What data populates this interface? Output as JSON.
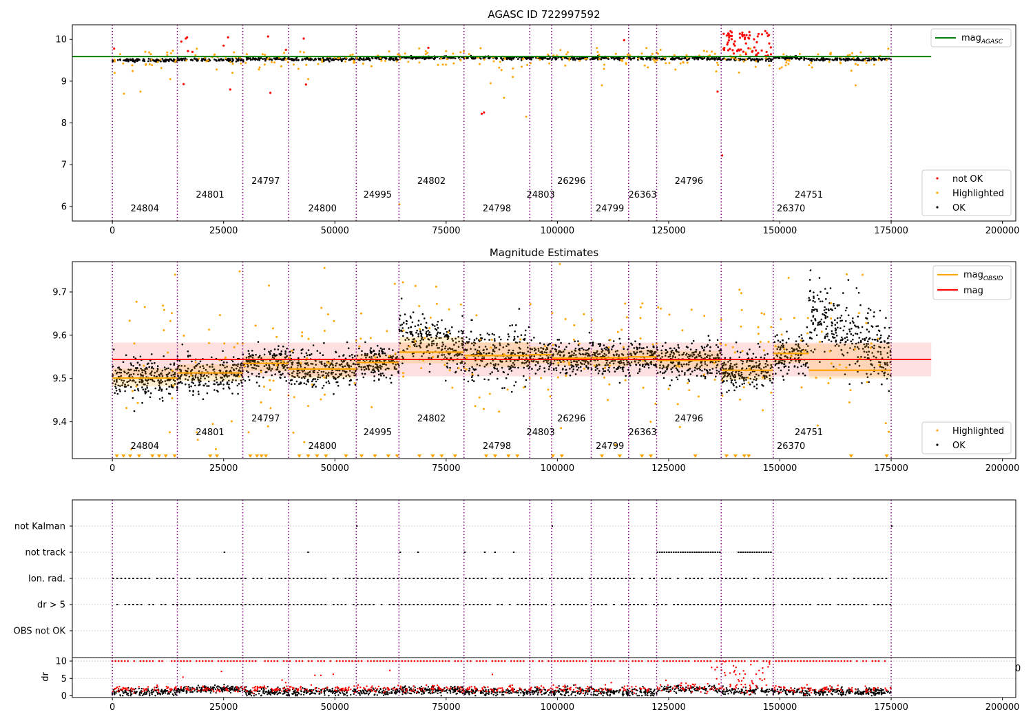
{
  "colors": {
    "ok": "#000000",
    "highlighted": "#ffa500",
    "not_ok": "#ff0000",
    "agasc_line": "#008000",
    "obsid_line": "#ffa500",
    "mag_line": "#ff0000",
    "mag_band": "#ffcccc",
    "obsid_boundary": "#800080",
    "gridline": "#b0b0b0"
  },
  "obsid_boundaries": [
    0,
    14600,
    29300,
    39600,
    54800,
    64400,
    79000,
    93800,
    98700,
    107600,
    116000,
    122300,
    136800,
    148500,
    175000
  ],
  "obsids": [
    {
      "label": "24804",
      "x": 7300,
      "row": 0
    },
    {
      "label": "24801",
      "x": 21950,
      "row": 1
    },
    {
      "label": "24797",
      "x": 34450,
      "row": 2
    },
    {
      "label": "24800",
      "x": 47200,
      "row": 0
    },
    {
      "label": "24995",
      "x": 59600,
      "row": 1
    },
    {
      "label": "24802",
      "x": 71700,
      "row": 2
    },
    {
      "label": "24798",
      "x": 86400,
      "row": 0
    },
    {
      "label": "24803",
      "x": 96250,
      "row": 1
    },
    {
      "label": "26296",
      "x": 103150,
      "row": 2
    },
    {
      "label": "24799",
      "x": 111800,
      "row": 0
    },
    {
      "label": "26363",
      "x": 119150,
      "row": 1
    },
    {
      "label": "24796",
      "x": 129550,
      "row": 2
    },
    {
      "label": "26370",
      "x": 152500,
      "row": 0
    },
    {
      "label": "24751",
      "x": 156500,
      "row": 1
    }
  ],
  "chart_data": [
    {
      "type": "scatter",
      "title": "AGASC ID 722997592",
      "xlim": [
        -9000,
        203000
      ],
      "ylim": [
        5.65,
        10.35
      ],
      "xticks": [
        0,
        25000,
        50000,
        75000,
        100000,
        125000,
        150000,
        175000,
        200000
      ],
      "yticks": [
        6,
        7,
        8,
        9,
        10
      ],
      "reference_lines": [
        {
          "name": "mag_AGASC",
          "y": 9.59,
          "x": [
            -9000,
            184000
          ],
          "color": "#008000"
        }
      ],
      "series": [
        {
          "name": "not OK",
          "color": "#ff0000"
        },
        {
          "name": "Highlighted",
          "color": "#ffa500"
        },
        {
          "name": "OK",
          "color": "#000000"
        }
      ],
      "legend_main": {
        "label_base": "mag",
        "label_sub": "AGASC",
        "position": "top-right"
      },
      "legend": {
        "labels": [
          "not OK",
          "Highlighted",
          "OK"
        ],
        "position": "bottom-right"
      }
    },
    {
      "type": "scatter",
      "title": "Magnitude Estimates",
      "xlim": [
        -9000,
        203000
      ],
      "ylim": [
        9.315,
        9.77
      ],
      "xticks": [
        0,
        25000,
        50000,
        75000,
        100000,
        125000,
        150000,
        175000,
        200000
      ],
      "yticks": [
        9.4,
        9.5,
        9.6,
        9.7
      ],
      "mag": 9.544,
      "mag_band": [
        9.505,
        9.583
      ],
      "obsid_mags": [
        {
          "x": [
            0,
            14600
          ],
          "mag": 9.501,
          "lo": 9.482,
          "hi": 9.523
        },
        {
          "x": [
            14600,
            29300
          ],
          "mag": 9.513,
          "lo": 9.494,
          "hi": 9.533
        },
        {
          "x": [
            29300,
            39600
          ],
          "mag": 9.535,
          "lo": 9.517,
          "hi": 9.552
        },
        {
          "x": [
            39600,
            54800
          ],
          "mag": 9.522,
          "lo": 9.5,
          "hi": 9.544
        },
        {
          "x": [
            54800,
            64400
          ],
          "mag": 9.537,
          "lo": 9.519,
          "hi": 9.556
        },
        {
          "x": [
            64400,
            79000
          ],
          "mag": 9.561,
          "lo": 9.535,
          "hi": 9.596
        },
        {
          "x": [
            79000,
            93800
          ],
          "mag": 9.553,
          "lo": 9.527,
          "hi": 9.584
        },
        {
          "x": [
            93800,
            98700
          ],
          "mag": 9.555,
          "lo": 9.535,
          "hi": 9.574
        },
        {
          "x": [
            98700,
            107600
          ],
          "mag": 9.547,
          "lo": 9.53,
          "hi": 9.566
        },
        {
          "x": [
            107600,
            116000
          ],
          "mag": 9.548,
          "lo": 9.528,
          "hi": 9.566
        },
        {
          "x": [
            116000,
            122300
          ],
          "mag": 9.55,
          "lo": 9.533,
          "hi": 9.567
        },
        {
          "x": [
            122300,
            136800
          ],
          "mag": 9.542,
          "lo": 9.523,
          "hi": 9.564
        },
        {
          "x": [
            136800,
            148500
          ],
          "mag": 9.519,
          "lo": 9.496,
          "hi": 9.544
        },
        {
          "x": [
            148500,
            156500
          ],
          "mag": 9.558,
          "lo": 9.535,
          "hi": 9.58
        },
        {
          "x": [
            156500,
            175000
          ],
          "mag": 9.519,
          "lo": 9.5,
          "hi": 9.58
        }
      ],
      "series": [
        {
          "name": "Highlighted",
          "color": "#ffa500"
        },
        {
          "name": "OK",
          "color": "#000000"
        }
      ],
      "legend_main": {
        "labels": [
          {
            "base": "mag",
            "sub": "OBSID",
            "color": "#ffa500"
          },
          {
            "base": "mag",
            "sub": "",
            "color": "#ff0000"
          }
        ],
        "position": "top-right"
      },
      "legend": {
        "labels": [
          "Highlighted",
          "OK"
        ],
        "position": "bottom-right"
      }
    },
    {
      "type": "scatter",
      "title": "",
      "xlim": [
        -9000,
        203000
      ],
      "categories": [
        "OBS not OK",
        "dr > 5",
        "Ion. rad.",
        "not track",
        "not Kalman"
      ]
    },
    {
      "type": "scatter",
      "title": "",
      "ylabel": "dr",
      "xlim": [
        -9000,
        203000
      ],
      "ylim": [
        -0.5,
        11
      ],
      "xticks": [
        0,
        25000,
        50000,
        75000,
        100000,
        125000,
        150000,
        175000,
        200000
      ],
      "yticks": [
        0,
        5,
        10
      ],
      "clipped_tick": "0"
    }
  ]
}
